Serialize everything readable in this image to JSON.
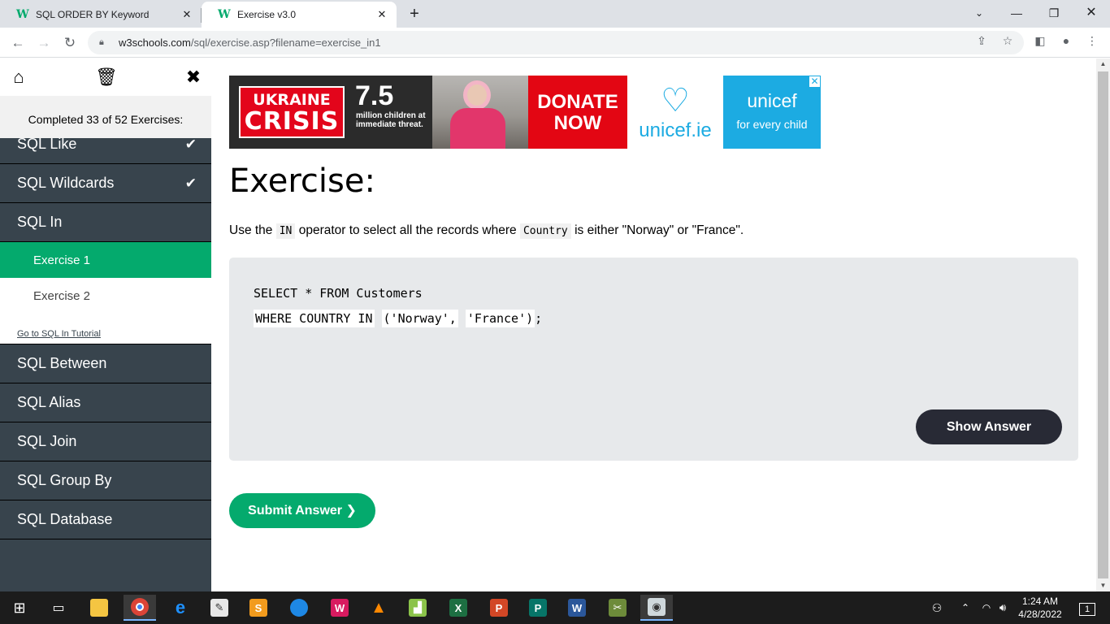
{
  "browser": {
    "tabs": [
      {
        "title": "SQL ORDER BY Keyword",
        "favicon": "w3schools-icon"
      },
      {
        "title": "Exercise v3.0",
        "favicon": "w3schools-icon"
      }
    ],
    "url_host": "w3schools.com",
    "url_path": "/sql/exercise.asp?filename=exercise_in1"
  },
  "sidebar": {
    "progress": "Completed 33 of 52 Exercises:",
    "items_above": [
      {
        "label": "SQL Like",
        "completed": true
      },
      {
        "label": "SQL Wildcards",
        "completed": true
      },
      {
        "label": "SQL In",
        "completed": false
      }
    ],
    "sub_items": [
      {
        "label": "Exercise 1",
        "active": true
      },
      {
        "label": "Exercise 2",
        "active": false
      }
    ],
    "tutorial_link": "Go to SQL In Tutorial",
    "items_below": [
      {
        "label": "SQL Between"
      },
      {
        "label": "SQL Alias"
      },
      {
        "label": "SQL Join"
      },
      {
        "label": "SQL Group By"
      },
      {
        "label": "SQL Database"
      }
    ]
  },
  "ad": {
    "crisis_line1": "UKRAINE",
    "crisis_line2": "CRISIS",
    "stat": "7.5",
    "stat_text": "million children at immediate threat.",
    "donate": "DONATE NOW",
    "site": "unicef.ie",
    "brand": "unicef",
    "tagline": "for every child",
    "colors": {
      "red": "#e30613",
      "unicef_blue": "#1cabe2"
    }
  },
  "exercise": {
    "title": "Exercise:",
    "instruction_pre": "Use the",
    "instruction_code1": "IN",
    "instruction_mid": "operator to select all the records where",
    "instruction_code2": "Country",
    "instruction_post": "is either \"Norway\" or \"France\".",
    "code_line1": "SELECT * FROM Customers",
    "code_line2_fill1": "WHERE COUNTRY IN",
    "code_line2_fill2": "('Norway',",
    "code_line2_fill3": "'France')",
    "code_line2_end": ";",
    "show_answer": "Show Answer",
    "submit": "Submit Answer ❯"
  },
  "taskbar": {
    "time": "1:24 AM",
    "date": "4/28/2022",
    "notifications": "1"
  },
  "colors": {
    "accent_green": "#04aa6d",
    "sidebar_dark": "#38444d",
    "button_dark": "#282a35"
  }
}
